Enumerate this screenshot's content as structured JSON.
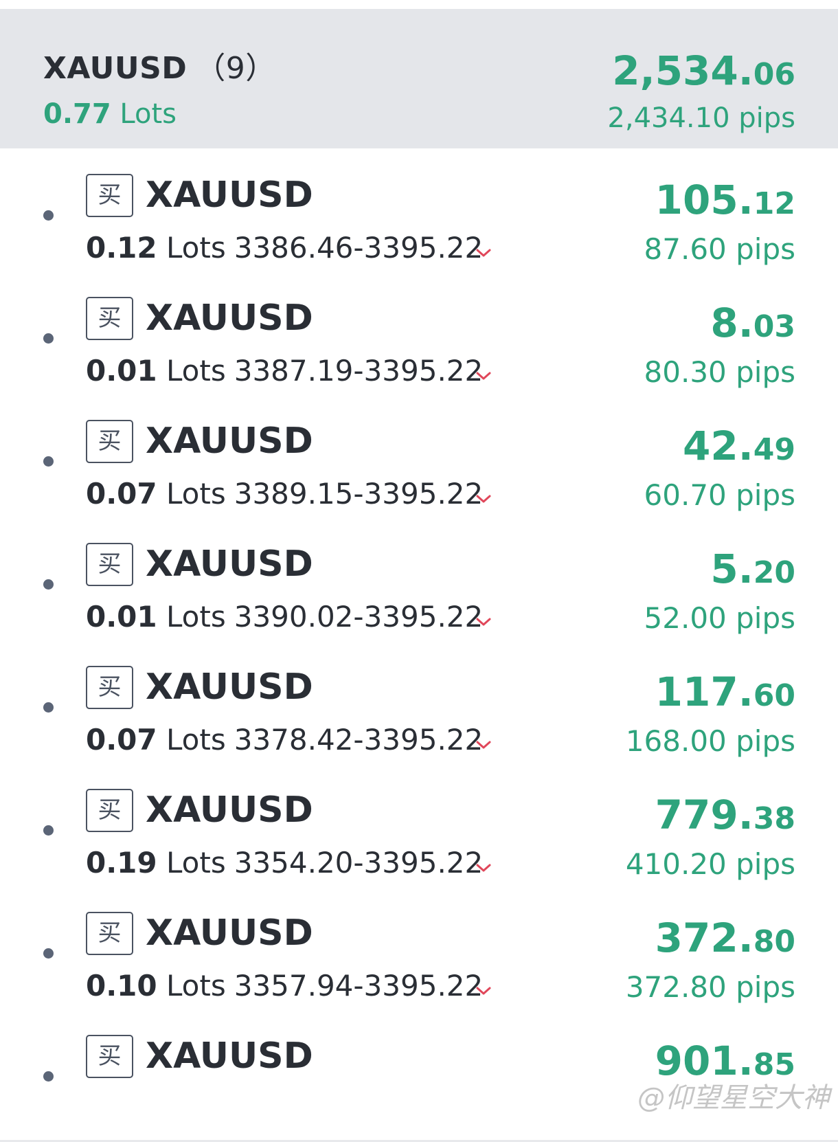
{
  "group": {
    "symbol": "XAUUSD",
    "count": "（9）",
    "lots_value": "0.77",
    "lots_unit": "Lots",
    "profit_int": "2,534.",
    "profit_dec": "06",
    "pips": "2,434.10 pips"
  },
  "positions": [
    {
      "side": "买",
      "symbol": "XAUUSD",
      "lots": "0.12",
      "lots_unit": "Lots",
      "range": "3386.46-3395.22",
      "profit_int": "105.",
      "profit_dec": "12",
      "pips": "87.60 pips"
    },
    {
      "side": "买",
      "symbol": "XAUUSD",
      "lots": "0.01",
      "lots_unit": "Lots",
      "range": "3387.19-3395.22",
      "profit_int": "8.",
      "profit_dec": "03",
      "pips": "80.30 pips"
    },
    {
      "side": "买",
      "symbol": "XAUUSD",
      "lots": "0.07",
      "lots_unit": "Lots",
      "range": "3389.15-3395.22",
      "profit_int": "42.",
      "profit_dec": "49",
      "pips": "60.70 pips"
    },
    {
      "side": "买",
      "symbol": "XAUUSD",
      "lots": "0.01",
      "lots_unit": "Lots",
      "range": "3390.02-3395.22",
      "profit_int": "5.",
      "profit_dec": "20",
      "pips": "52.00 pips"
    },
    {
      "side": "买",
      "symbol": "XAUUSD",
      "lots": "0.07",
      "lots_unit": "Lots",
      "range": "3378.42-3395.22",
      "profit_int": "117.",
      "profit_dec": "60",
      "pips": "168.00 pips"
    },
    {
      "side": "买",
      "symbol": "XAUUSD",
      "lots": "0.19",
      "lots_unit": "Lots",
      "range": "3354.20-3395.22",
      "profit_int": "779.",
      "profit_dec": "38",
      "pips": "410.20 pips"
    },
    {
      "side": "买",
      "symbol": "XAUUSD",
      "lots": "0.10",
      "lots_unit": "Lots",
      "range": "3357.94-3395.22",
      "profit_int": "372.",
      "profit_dec": "80",
      "pips": "372.80 pips"
    },
    {
      "side": "买",
      "symbol": "XAUUSD",
      "lots": "",
      "lots_unit": "",
      "range": "",
      "profit_int": "901.",
      "profit_dec": "85",
      "pips": ""
    }
  ],
  "watermark": "@仰望星空大神",
  "colors": {
    "profit_green": "#2ea37c",
    "header_bg": "#e4e6ea",
    "text_dark": "#2a2e35",
    "chevron_red": "#e0475a",
    "dot_gray": "#5b6577"
  },
  "icons": {
    "expand": "chevron-down-icon",
    "watermark_logo": "weibo-logo"
  }
}
